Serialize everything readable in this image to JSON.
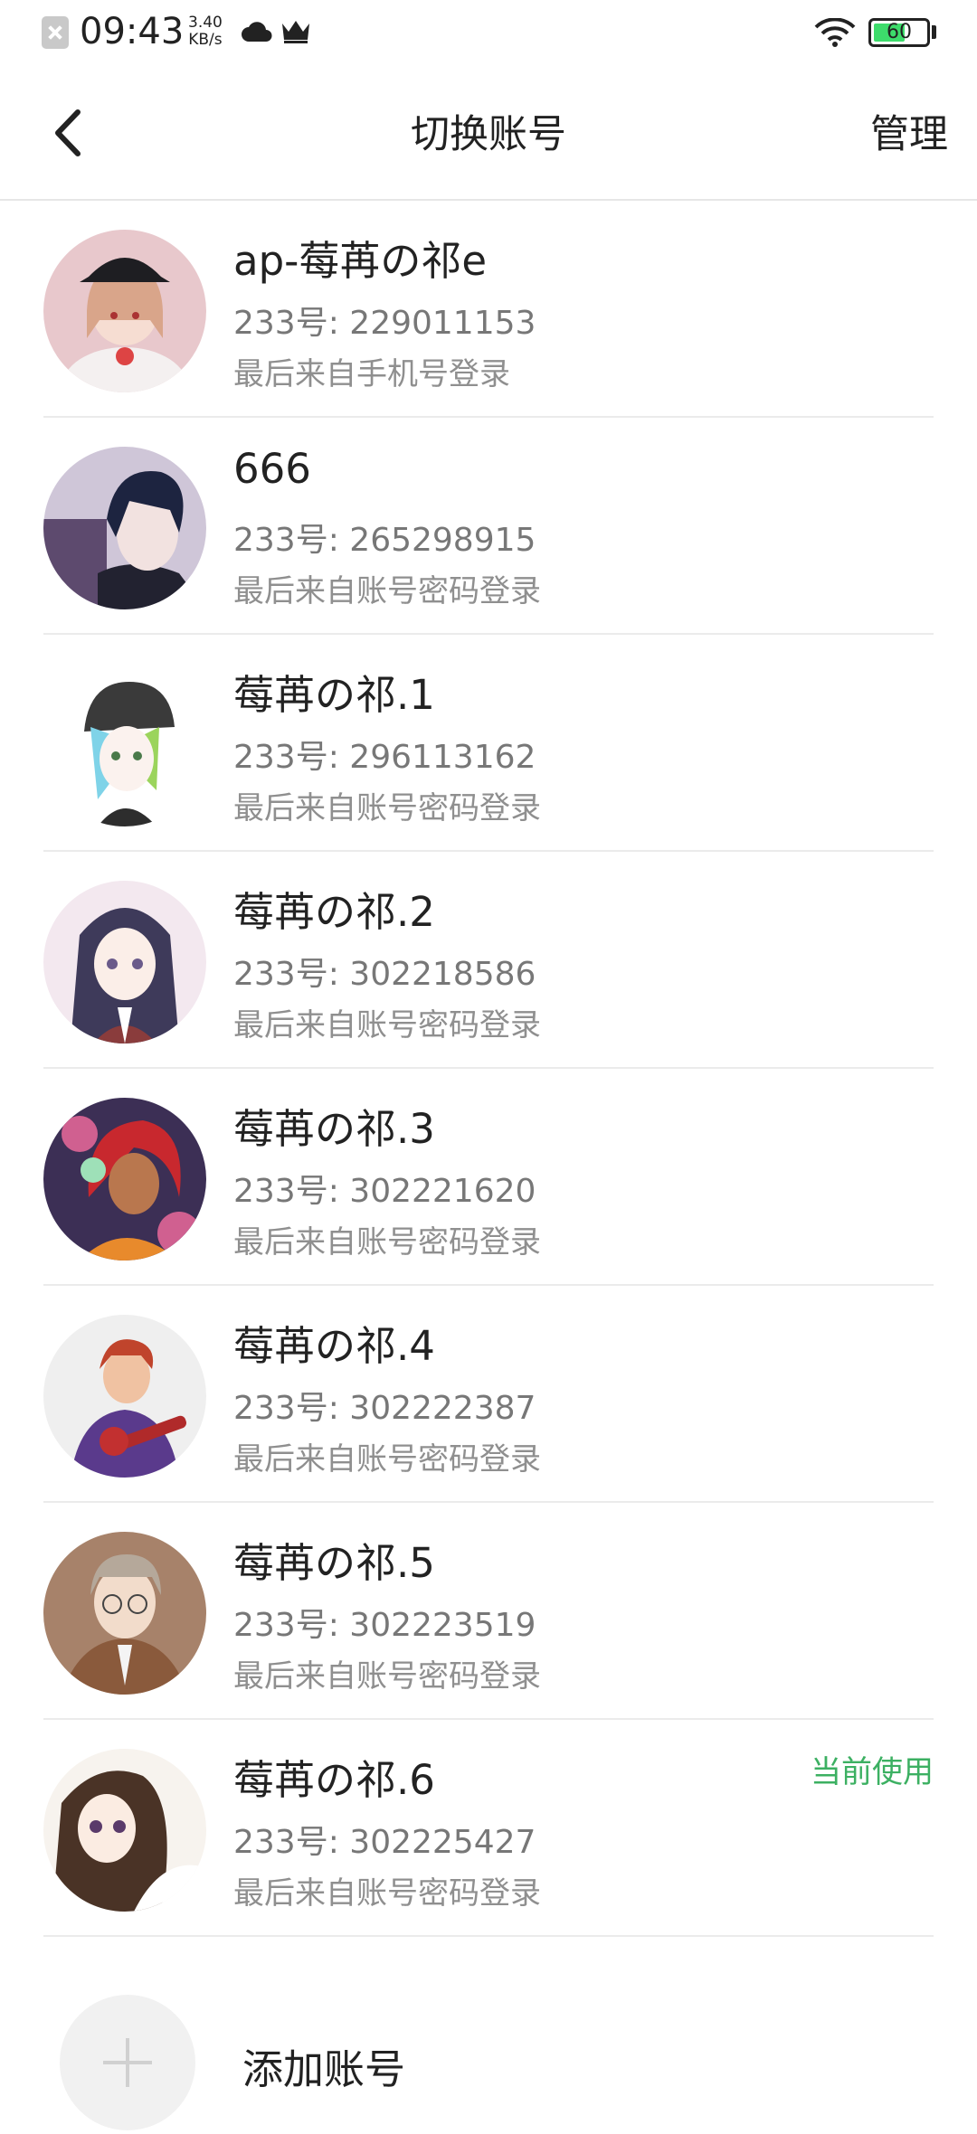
{
  "status_bar": {
    "time": "09:43",
    "speed_value": "3.40",
    "speed_unit": "KB/s",
    "battery": "60",
    "battery_level": 0.6,
    "battery_color": "#3ddc6b"
  },
  "header": {
    "title": "切换账号",
    "manage_label": "管理"
  },
  "accounts": [
    {
      "name": "ap-莓苒の祁e",
      "uid": "233号: 229011153",
      "login": "最后来自手机号登录",
      "current": "",
      "avatar": "avatar-girl-cap"
    },
    {
      "name": "666",
      "uid": "233号: 265298915",
      "login": "最后来自账号密码登录",
      "current": "",
      "avatar": "avatar-dark-hair-boy"
    },
    {
      "name": "莓苒の祁.1",
      "uid": "233号: 296113162",
      "login": "最后来自账号密码登录",
      "current": "",
      "avatar": "avatar-beanie-girl"
    },
    {
      "name": "莓苒の祁.2",
      "uid": "233号: 302218586",
      "login": "最后来自账号密码登录",
      "current": "",
      "avatar": "avatar-bunny-girl"
    },
    {
      "name": "莓苒の祁.3",
      "uid": "233号: 302221620",
      "login": "最后来自账号密码登录",
      "current": "",
      "avatar": "avatar-red-hair-girl"
    },
    {
      "name": "莓苒の祁.4",
      "uid": "233号: 302222387",
      "login": "最后来自账号密码登录",
      "current": "",
      "avatar": "avatar-guitar-boy"
    },
    {
      "name": "莓苒の祁.5",
      "uid": "233号: 302223519",
      "login": "最后来自账号密码登录",
      "current": "",
      "avatar": "avatar-glasses-man"
    },
    {
      "name": "莓苒の祁.6",
      "uid": "233号: 302225427",
      "login": "最后来自账号密码登录",
      "current": "当前使用",
      "avatar": "avatar-brown-hair-girl"
    }
  ],
  "add_account": {
    "label": "添加账号",
    "icon": "plus-icon"
  },
  "colors": {
    "current_badge": "#3cb062"
  }
}
